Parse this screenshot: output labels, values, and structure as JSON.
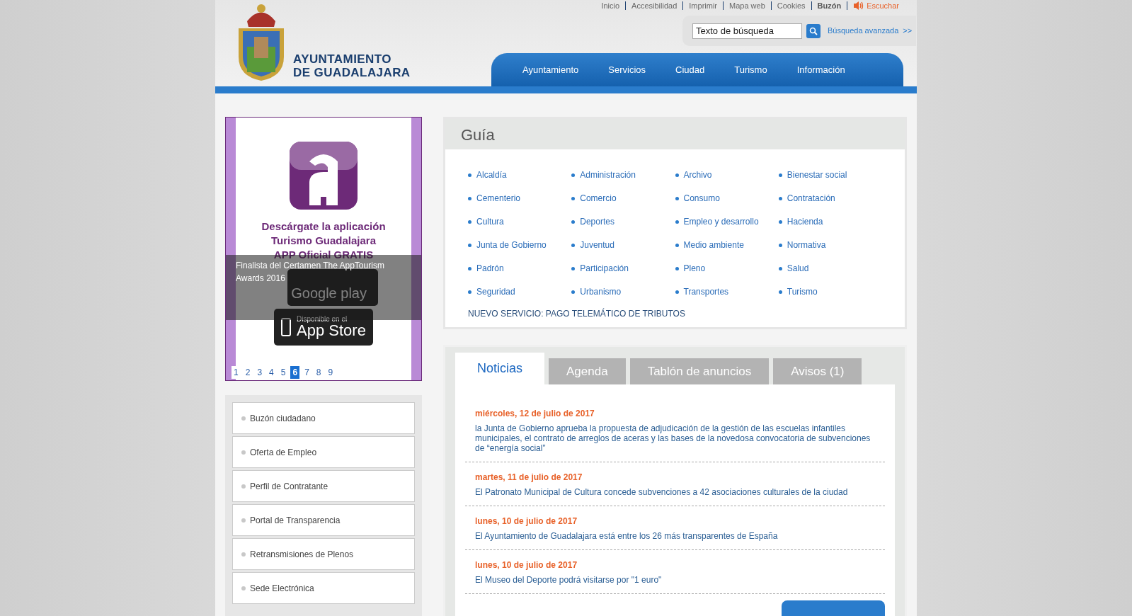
{
  "top_links": [
    {
      "label": "Inicio",
      "kind": "plain"
    },
    {
      "label": "Accesibilidad",
      "kind": "plain"
    },
    {
      "label": "Imprimir",
      "kind": "plain"
    },
    {
      "label": "Mapa web",
      "kind": "plain"
    },
    {
      "label": "Cookies",
      "kind": "plain"
    },
    {
      "label": "Buzón",
      "kind": "bold"
    },
    {
      "label": "Escuchar",
      "kind": "audio"
    }
  ],
  "logo": {
    "line1": "AYUNTAMIENTO",
    "line2": "DE GUADALAJARA"
  },
  "search": {
    "placeholder": "Texto de búsqueda",
    "advanced": "Búsqueda avanzada",
    "advanced_arrow": ">>"
  },
  "nav": [
    "Ayuntamiento",
    "Servicios",
    "Ciudad",
    "Turismo",
    "Información"
  ],
  "banner": {
    "headline": [
      "Descárgate la aplicación",
      "Turismo Guadalajara",
      "APP Oficial GRATIS"
    ],
    "google_play": "Google play",
    "app_store_small": "Disponible en el",
    "app_store": "App Store",
    "caption": "Finalista del Certamen The AppTourism Awards 2016",
    "pages": [
      {
        "label": "1",
        "selected": false
      },
      {
        "label": "2",
        "selected": false
      },
      {
        "label": "3",
        "selected": false
      },
      {
        "label": "4",
        "selected": false
      },
      {
        "label": "5",
        "selected": false
      },
      {
        "label": "6",
        "selected": true
      },
      {
        "label": "7",
        "selected": false
      },
      {
        "label": "8",
        "selected": false
      },
      {
        "label": "9",
        "selected": false
      }
    ]
  },
  "quick_links": [
    "Buzón ciudadano",
    "Oferta de Empleo",
    "Perfil de Contratante",
    "Portal de Transparencia",
    "Retransmisiones de Plenos",
    "Sede Electrónica"
  ],
  "guide": {
    "title": "Guía",
    "items": [
      "Alcaldía",
      "Administración",
      "Archivo",
      "Bienestar social",
      "Cementerio",
      "Comercio",
      "Consumo",
      "Contratación",
      "Cultura",
      "Deportes",
      "Empleo y desarrollo",
      "Hacienda",
      "Junta de Gobierno",
      "Juventud",
      "Medio ambiente",
      "Normativa",
      "Padrón",
      "Participación",
      "Pleno",
      "Salud",
      "Seguridad",
      "Urbanismo",
      "Transportes",
      "Turismo"
    ],
    "notice": "NUEVO SERVICIO: PAGO TELEMÁTICO DE TRIBUTOS"
  },
  "tabs": [
    {
      "label": "Noticias",
      "selected": true
    },
    {
      "label": "Agenda",
      "selected": false
    },
    {
      "label": "Tablón de anuncios",
      "selected": false
    },
    {
      "label": "Avisos (1)",
      "selected": false
    }
  ],
  "news": [
    {
      "date": "miércoles, 12 de julio de 2017",
      "title": "la Junta de Gobierno aprueba la propuesta de adjudicación de la gestión de las escuelas infantiles municipales, el contrato de arreglos de aceras y las bases de la novedosa convocatoria de subvenciones de “energía social”"
    },
    {
      "date": "martes, 11 de julio de 2017",
      "title": "El Patronato Municipal de Cultura concede subvenciones a 42 asociaciones culturales de la ciudad"
    },
    {
      "date": "lunes, 10 de julio de 2017",
      "title": "El Ayuntamiento de Guadalajara está entre los 26 más transparentes de España"
    },
    {
      "date": "lunes, 10 de julio de 2017",
      "title": "El Museo del Deporte podrá visitarse por \"1 euro\""
    }
  ]
}
